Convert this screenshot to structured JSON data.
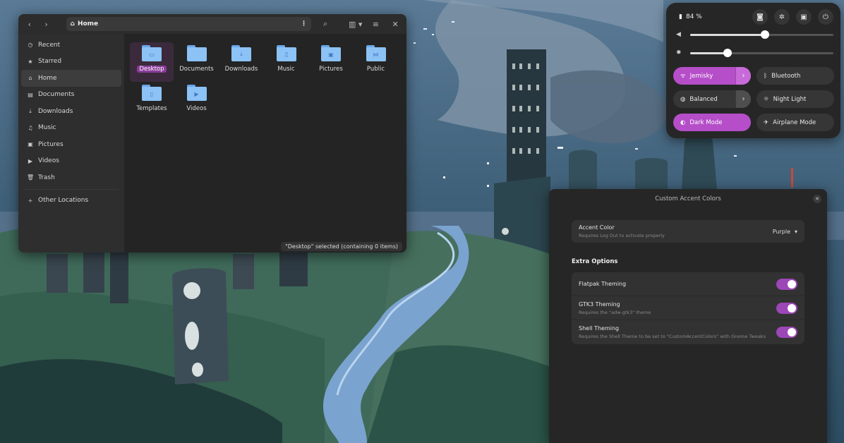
{
  "files": {
    "location": "Home",
    "sidebar": [
      {
        "icon": "clock-icon",
        "label": "Recent"
      },
      {
        "icon": "star-icon",
        "label": "Starred"
      },
      {
        "icon": "home-icon",
        "label": "Home"
      },
      {
        "icon": "document-icon",
        "label": "Documents"
      },
      {
        "icon": "download-icon",
        "label": "Downloads"
      },
      {
        "icon": "music-icon",
        "label": "Music"
      },
      {
        "icon": "picture-icon",
        "label": "Pictures"
      },
      {
        "icon": "video-icon",
        "label": "Videos"
      },
      {
        "icon": "trash-icon",
        "label": "Trash"
      }
    ],
    "other_locations": "Other Locations",
    "folders": [
      {
        "name": "Desktop",
        "emblem": "▭",
        "selected": true
      },
      {
        "name": "Documents",
        "emblem": "",
        "selected": false
      },
      {
        "name": "Downloads",
        "emblem": "⤓",
        "selected": false
      },
      {
        "name": "Music",
        "emblem": "♫",
        "selected": false
      },
      {
        "name": "Pictures",
        "emblem": "▣",
        "selected": false
      },
      {
        "name": "Public",
        "emblem": "⋈",
        "selected": false
      },
      {
        "name": "Templates",
        "emblem": "▯",
        "selected": false
      },
      {
        "name": "Videos",
        "emblem": "▶",
        "selected": false
      }
    ],
    "status": "\"Desktop\" selected (containing 0 items)"
  },
  "quick_settings": {
    "battery": "84 %",
    "volume_level": 0.52,
    "brightness_level": 0.26,
    "toggles": [
      {
        "label": "Jemisky",
        "icon": "wifi-icon",
        "on": true,
        "arrow": true
      },
      {
        "label": "Bluetooth",
        "icon": "bluetooth-icon",
        "on": false,
        "arrow": false
      },
      {
        "label": "Balanced",
        "icon": "power-profile-icon",
        "on": false,
        "arrow": true
      },
      {
        "label": "Night Light",
        "icon": "night-light-icon",
        "on": false,
        "arrow": false
      },
      {
        "label": "Dark Mode",
        "icon": "dark-mode-icon",
        "on": true,
        "arrow": false
      },
      {
        "label": "Airplane Mode",
        "icon": "airplane-icon",
        "on": false,
        "arrow": false
      }
    ]
  },
  "accent_window": {
    "title": "Custom Accent Colors",
    "accent_color": {
      "label": "Accent Color",
      "subtitle": "Requires Log Out to activate properly",
      "value": "Purple"
    },
    "extra_options_title": "Extra Options",
    "options": [
      {
        "label": "Flatpak Theming",
        "subtitle": "",
        "on": true
      },
      {
        "label": "GTK3 Theming",
        "subtitle": "Requires the \"adw-gtk3\" theme",
        "on": true
      },
      {
        "label": "Shell Theming",
        "subtitle": "Requires the Shell Theme to be set to \"CustomAccentColors\" with Gnome Tweaks",
        "on": true
      }
    ]
  },
  "colors": {
    "accent": "#b54ec8",
    "folder": "#8cc2f5"
  }
}
